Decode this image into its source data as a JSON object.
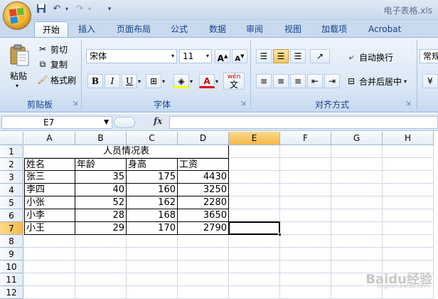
{
  "title_bar": {
    "title": "电子表格.xls"
  },
  "quick_access": {
    "save_icon": "save-icon",
    "undo_icon": "undo-icon",
    "redo_icon": "redo-icon",
    "more_icon": "customize-icon"
  },
  "tabs": [
    "开始",
    "插入",
    "页面布局",
    "公式",
    "数据",
    "审阅",
    "视图",
    "加载项",
    "Acrobat"
  ],
  "ribbon": {
    "clipboard": {
      "label": "剪贴板",
      "paste": "粘贴",
      "cut": "剪切",
      "copy": "复制",
      "format_painter": "格式刷"
    },
    "font": {
      "label": "字体",
      "font_name": "宋体",
      "font_size": "11",
      "grow": "A",
      "shrink": "A",
      "bold": "B",
      "italic": "I",
      "underline": "U",
      "wen": "wén",
      "wen_char": "文"
    },
    "alignment": {
      "label": "对齐方式",
      "wrap": "自动换行",
      "merge": "合并后居中"
    },
    "number": {
      "format": "常规"
    }
  },
  "formula_bar": {
    "cell_ref": "E7",
    "fx": "fx",
    "value": ""
  },
  "columns": [
    "A",
    "B",
    "C",
    "D",
    "E",
    "F",
    "G",
    "H"
  ],
  "rows": [
    "1",
    "2",
    "3",
    "4",
    "5",
    "6",
    "7",
    "8",
    "9",
    "10",
    "11",
    "12"
  ],
  "selected_cell": {
    "col": "E",
    "row": "7"
  },
  "sheet": {
    "title": "人员情况表",
    "headers": [
      "姓名",
      "年龄",
      "身高",
      "工资"
    ],
    "data": [
      [
        "张三",
        "35",
        "175",
        "4430"
      ],
      [
        "李四",
        "40",
        "160",
        "3250"
      ],
      [
        "小张",
        "52",
        "162",
        "2280"
      ],
      [
        "小李",
        "28",
        "168",
        "3650"
      ],
      [
        "小王",
        "29",
        "170",
        "2790"
      ]
    ]
  },
  "watermark": {
    "text": "Baidu经验",
    "sub": "jingyan.baidu.com"
  }
}
